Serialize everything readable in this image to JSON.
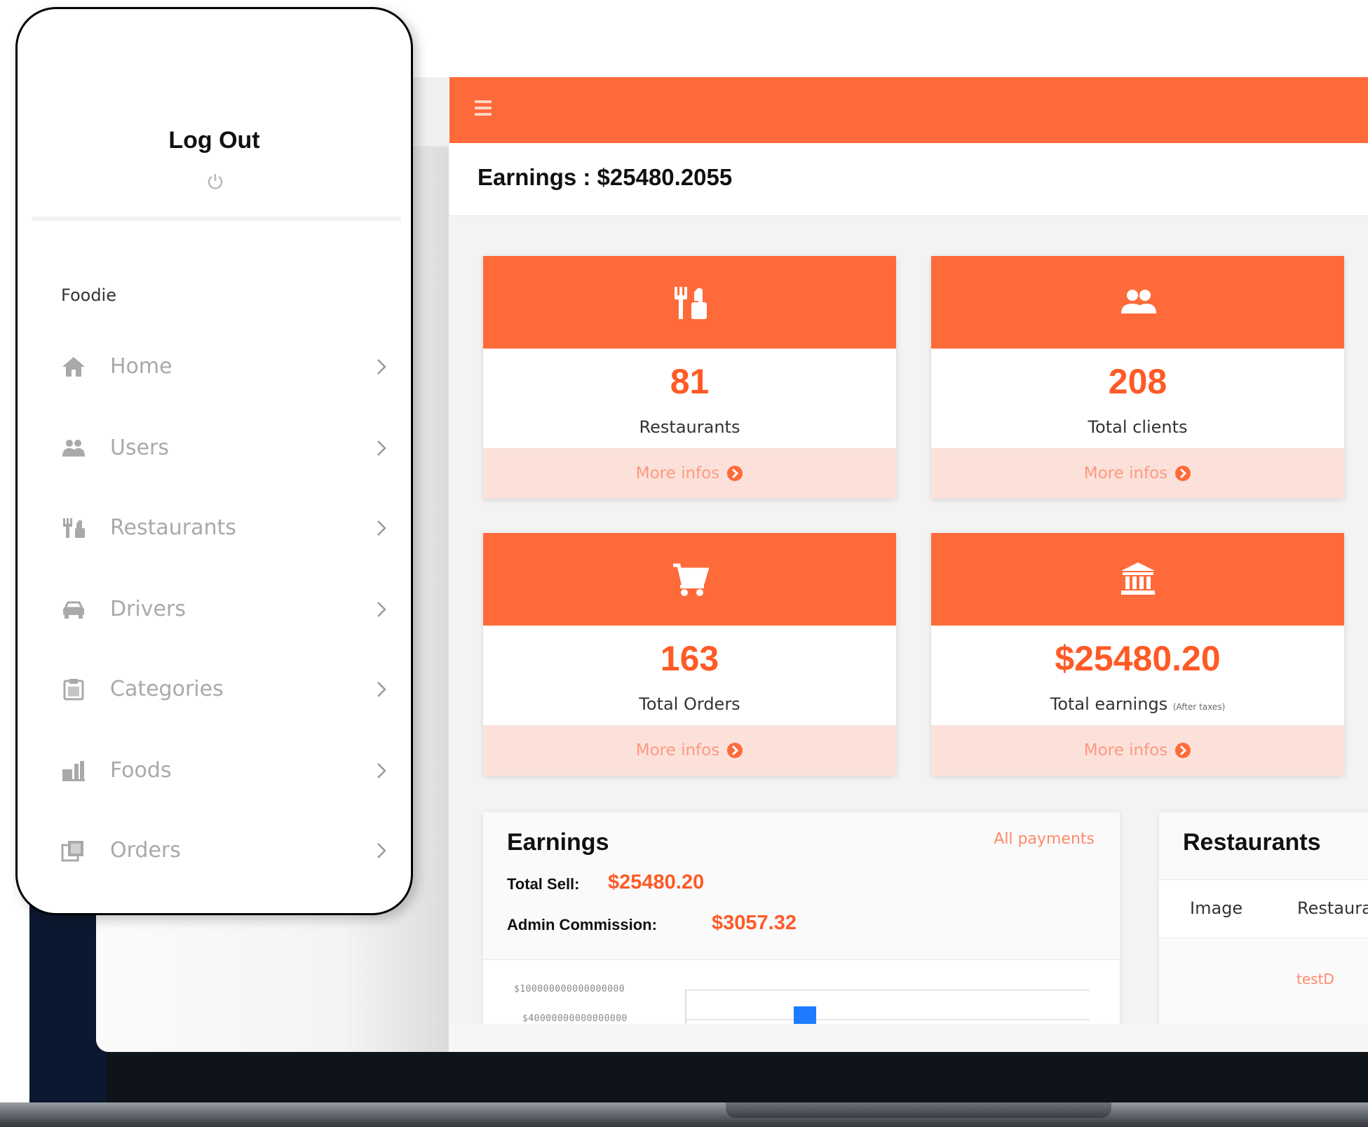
{
  "header": {
    "earnings_heading": "Earnings : $25480.2055"
  },
  "cards": [
    {
      "value": "81",
      "label": "Restaurants",
      "label_note": "",
      "more": "More infos"
    },
    {
      "value": "208",
      "label": "Total clients",
      "label_note": "",
      "more": "More infos"
    },
    {
      "value": "163",
      "label": "Total Orders",
      "label_note": "",
      "more": "More infos"
    },
    {
      "value": "$25480.20",
      "label": "Total earnings",
      "label_note": "(After taxes)",
      "more": "More infos"
    }
  ],
  "earnings_panel": {
    "title": "Earnings",
    "all_payments": "All payments",
    "total_sell_label": "Total Sell:",
    "total_sell_value": "$25480.20",
    "admin_commission_label": "Admin Commission:",
    "admin_commission_value": "$3057.32",
    "ticks": [
      "$100000000000000000",
      "$40000000000000000"
    ]
  },
  "restaurants_panel": {
    "title": "Restaurants",
    "columns": [
      "Image",
      "Restaurant"
    ],
    "rows": [
      {
        "name": "testD"
      }
    ]
  },
  "sidebar": {
    "logout": "Log Out",
    "brand": "Foodie",
    "items": [
      {
        "label": "Home",
        "icon": "home-icon"
      },
      {
        "label": "Users",
        "icon": "users-icon"
      },
      {
        "label": "Restaurants",
        "icon": "restaurants-icon"
      },
      {
        "label": "Drivers",
        "icon": "car-icon"
      },
      {
        "label": "Categories",
        "icon": "clipboard-icon"
      },
      {
        "label": "Foods",
        "icon": "foods-icon"
      },
      {
        "label": "Orders",
        "icon": "orders-icon"
      }
    ]
  },
  "colors": {
    "accent": "#ff6a3a",
    "accent_text": "#ff5a26",
    "card_footer": "#fbe1da",
    "link": "#ff8a6a",
    "bar": "#1e7bff"
  }
}
